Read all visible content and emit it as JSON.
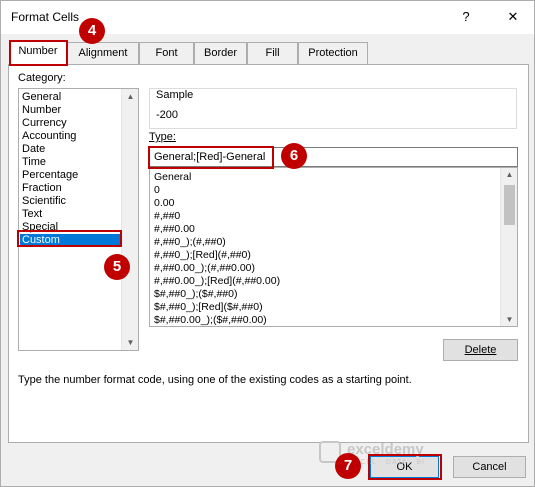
{
  "window": {
    "title": "Format Cells",
    "help_glyph": "?",
    "close_glyph": "✕"
  },
  "tabs": [
    "Number",
    "Alignment",
    "Font",
    "Border",
    "Fill",
    "Protection"
  ],
  "category": {
    "label": "Category:",
    "items": [
      "General",
      "Number",
      "Currency",
      "Accounting",
      "Date",
      "Time",
      "Percentage",
      "Fraction",
      "Scientific",
      "Text",
      "Special",
      "Custom"
    ],
    "selected": "Custom"
  },
  "sample": {
    "label": "Sample",
    "value": "-200"
  },
  "type": {
    "label": "Type:",
    "value": "General;[Red]-General",
    "codes": [
      "General",
      "0",
      "0.00",
      "#,##0",
      "#,##0.00",
      "#,##0_);(#,##0)",
      "#,##0_);[Red](#,##0)",
      "#,##0.00_);(#,##0.00)",
      "#,##0.00_);[Red](#,##0.00)",
      "$#,##0_);($#,##0)",
      "$#,##0_);[Red]($#,##0)",
      "$#,##0.00_);($#,##0.00)"
    ]
  },
  "buttons": {
    "delete": "Delete",
    "ok": "OK",
    "cancel": "Cancel"
  },
  "hint": "Type the number format code, using one of the existing codes as a starting point.",
  "annotations": [
    "4",
    "5",
    "6",
    "7"
  ],
  "watermark": {
    "name": "exceldemy",
    "tagline": "EXCEL · DATA · BI"
  },
  "colors": {
    "highlight": "#c00000",
    "selection": "#0078d7"
  }
}
